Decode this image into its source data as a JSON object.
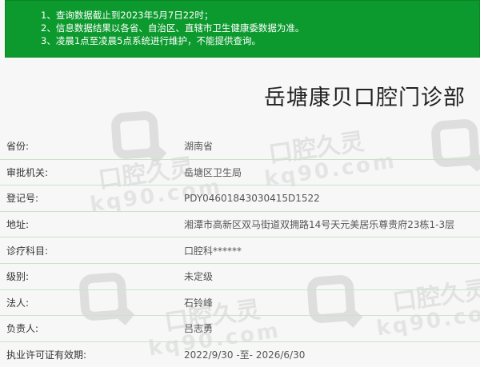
{
  "notice": {
    "lines": [
      "1、查询数据截止到2023年5月7日22时；",
      "2、信息数据结果以各省、自治区、直辖市卫生健康委数据为准。",
      "3、凌晨1点至凌晨5点系统进行维护，不能提供查询。"
    ]
  },
  "page_title": "岳塘康贝口腔门诊部",
  "rows": [
    {
      "label": "省份:",
      "value": "湖南省"
    },
    {
      "label": "审批机关:",
      "value": "岳塘区卫生局"
    },
    {
      "label": "登记号:",
      "value": "PDY04601843030415D1522"
    },
    {
      "label": "地址:",
      "value": "湘潭市高新区双马街道双拥路14号天元美居乐尊贵府23栋1-3层"
    },
    {
      "label": "诊疗科目:",
      "value": "口腔科******"
    },
    {
      "label": "级别:",
      "value": "未定级"
    },
    {
      "label": "法人:",
      "value": "石铃峰"
    },
    {
      "label": "负责人:",
      "value": "吕志勇"
    },
    {
      "label": "执业许可证有效期:",
      "value": "2022/9/30 -至- 2026/6/30"
    }
  ],
  "watermark": {
    "brand": "口腔久灵",
    "domain": "kq90.com"
  }
}
